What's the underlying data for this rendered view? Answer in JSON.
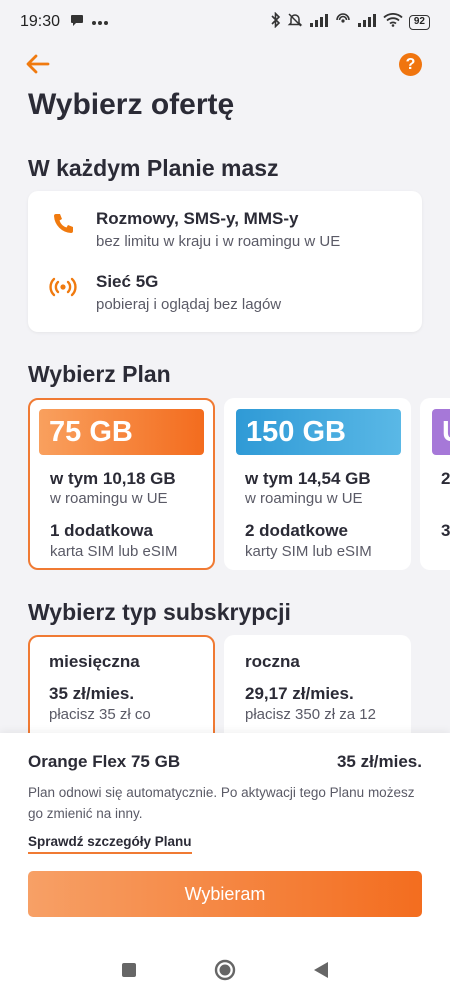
{
  "status_bar": {
    "time": "19:30",
    "battery": "92"
  },
  "header": {
    "back_icon": "arrow-left-icon",
    "help_label": "?",
    "title": "Wybierz ofertę"
  },
  "included": {
    "title": "W każdym Planie masz",
    "features": [
      {
        "icon": "phone-icon",
        "title": "Rozmowy, SMS-y, MMS-y",
        "subtitle": "bez limitu w kraju i w roamingu w UE"
      },
      {
        "icon": "signal-5g-icon",
        "title": "Sieć 5G",
        "subtitle": "pobieraj i oglądaj bez lagów"
      }
    ]
  },
  "plans": {
    "title": "Wybierz Plan",
    "items": [
      {
        "badge": "75 GB",
        "roaming": "w tym 10,18 GB",
        "roaming_note": "w roamingu w UE",
        "sim": "1 dodatkowa",
        "sim_note": "karta SIM lub eSIM",
        "selected": true,
        "color_from": "#f36c1e",
        "color_to": "#f9a55e"
      },
      {
        "badge": "150 GB",
        "roaming": "w tym 14,54 GB",
        "roaming_note": "w roamingu w UE",
        "sim": "2 dodatkowe",
        "sim_note": "karty SIM lub eSIM",
        "selected": false,
        "color_from": "#2f9ad6",
        "color_to": "#5ab8e6"
      },
      {
        "badge": "U",
        "roaming": "2",
        "roaming_note": "",
        "sim": "3",
        "sim_note": "",
        "selected": false,
        "color_from": "#a678d8",
        "color_to": "#b68be0"
      }
    ]
  },
  "subscription": {
    "title": "Wybierz typ subskrypcji",
    "items": [
      {
        "name": "miesięczna",
        "price": "35 zł/mies.",
        "note": "płacisz 35 zł co",
        "selected": true
      },
      {
        "name": "roczna",
        "price": "29,17 zł/mies.",
        "note": "płacisz 350 zł za 12",
        "selected": false
      }
    ]
  },
  "summary": {
    "plan_name": "Orange Flex 75 GB",
    "price": "35 zł/mies.",
    "description": "Plan odnowi się automatycznie. Po aktywacji tego Planu możesz go zmienić na inny.",
    "details_link": "Sprawdź szczegóły Planu",
    "cta": "Wybieram"
  },
  "colors": {
    "accent": "#f07a33",
    "text": "#2b2b36",
    "muted": "#5a5a66",
    "background": "#f3f3f6"
  }
}
